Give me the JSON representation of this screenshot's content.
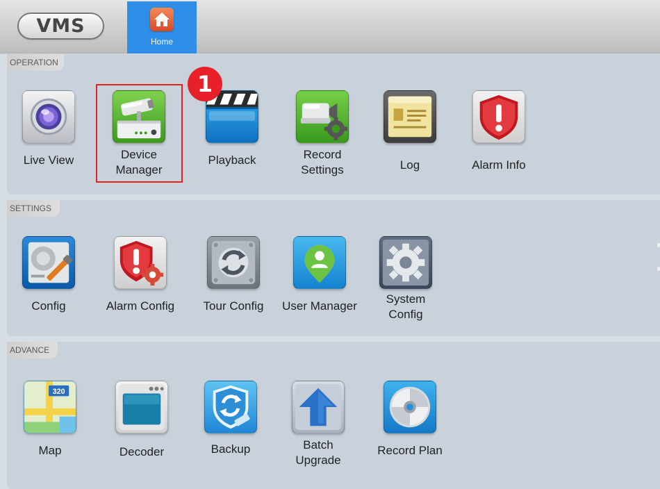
{
  "app": {
    "logo": "VMS"
  },
  "header": {
    "home_tab": {
      "label": "Home",
      "icon": "home-icon"
    }
  },
  "annotation": {
    "badge_number": "1",
    "highlight_color": "#e02424"
  },
  "colors": {
    "accent": "#2f8ee8",
    "section_bg": "#c9d1da",
    "badge": "#e8202a"
  },
  "sections": {
    "operation": {
      "label": "OPERATION",
      "items": [
        {
          "l1": "Live View",
          "l2": "",
          "icon": "live-view-icon"
        },
        {
          "l1": "Device",
          "l2": "Manager",
          "icon": "device-manager-icon"
        },
        {
          "l1": "Playback",
          "l2": "",
          "icon": "playback-icon"
        },
        {
          "l1": "Record",
          "l2": "Settings",
          "icon": "record-settings-icon"
        },
        {
          "l1": "Log",
          "l2": "",
          "icon": "log-icon"
        },
        {
          "l1": "Alarm Info",
          "l2": "",
          "icon": "alarm-info-icon"
        }
      ]
    },
    "settings": {
      "label": "SETTINGS",
      "items": [
        {
          "l1": "Config",
          "l2": "",
          "icon": "config-icon"
        },
        {
          "l1": "Alarm Config",
          "l2": "",
          "icon": "alarm-config-icon"
        },
        {
          "l1": "Tour Config",
          "l2": "",
          "icon": "tour-config-icon"
        },
        {
          "l1": "User Manager",
          "l2": "",
          "icon": "user-manager-icon"
        },
        {
          "l1": "System",
          "l2": "Config",
          "icon": "system-config-icon"
        }
      ]
    },
    "advance": {
      "label": "ADVANCE",
      "items": [
        {
          "l1": "Map",
          "l2": "",
          "icon": "map-icon"
        },
        {
          "l1": "Decoder",
          "l2": "",
          "icon": "decoder-icon"
        },
        {
          "l1": "Backup",
          "l2": "",
          "icon": "backup-icon"
        },
        {
          "l1": "Batch",
          "l2": "Upgrade",
          "icon": "batch-upgrade-icon"
        },
        {
          "l1": "Record Plan",
          "l2": "",
          "icon": "record-plan-icon"
        }
      ],
      "map_badge_text": "320"
    }
  }
}
